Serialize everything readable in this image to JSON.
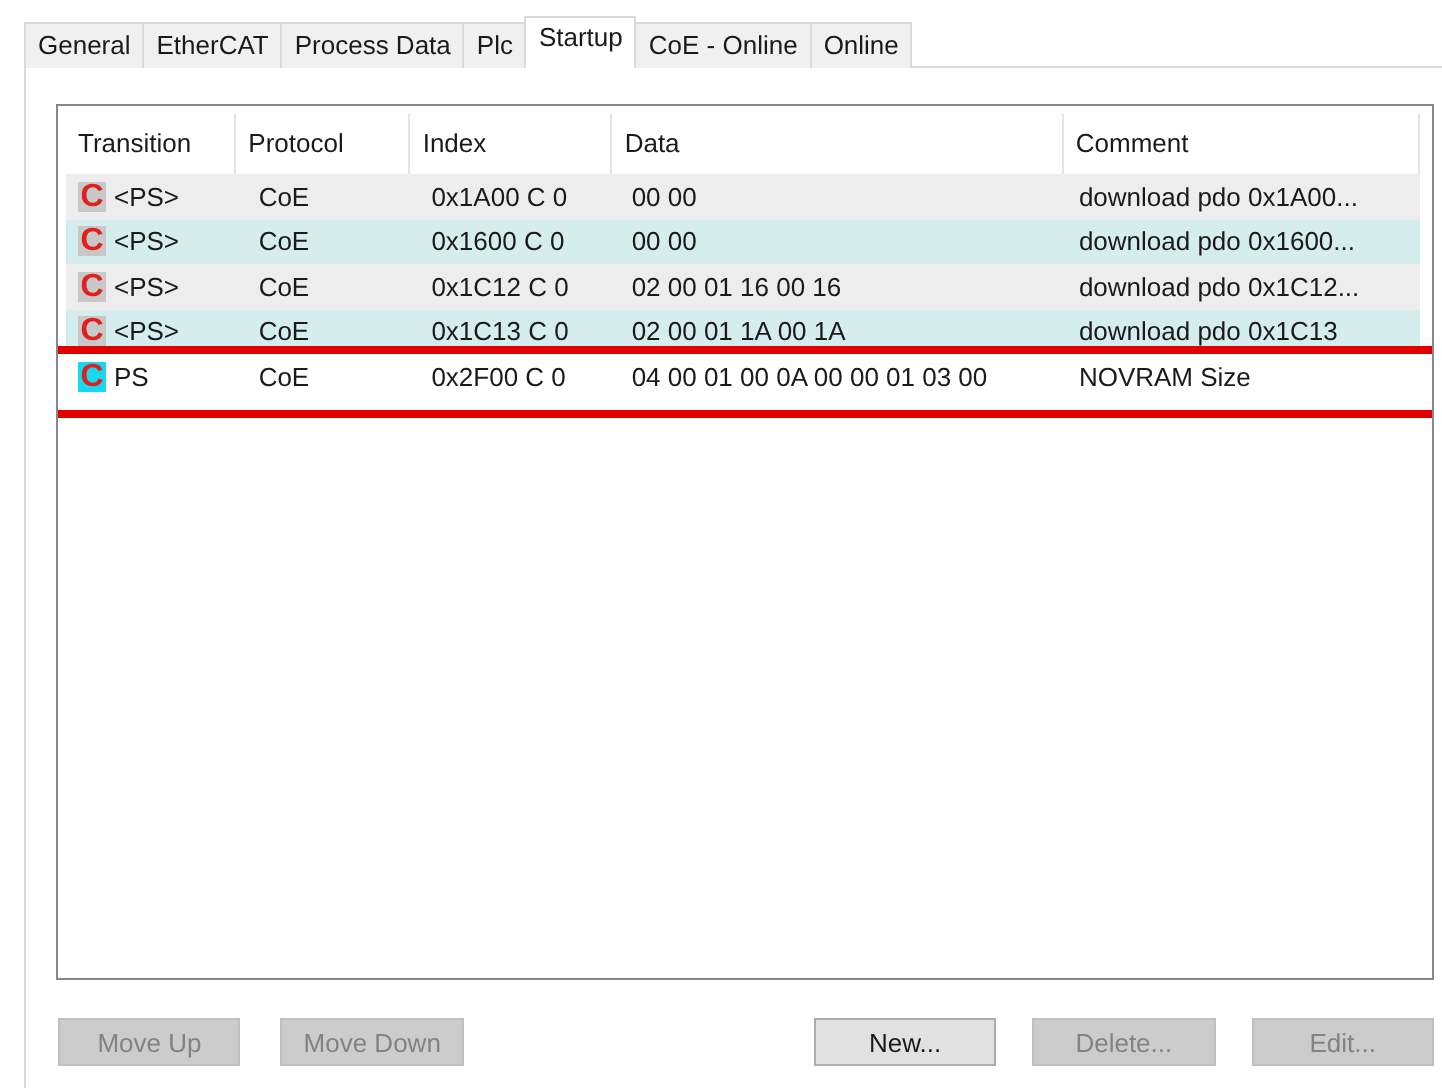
{
  "tabs": [
    {
      "label": "General",
      "selected": false
    },
    {
      "label": "EtherCAT",
      "selected": false
    },
    {
      "label": "Process Data",
      "selected": false
    },
    {
      "label": "Plc",
      "selected": false
    },
    {
      "label": "Startup",
      "selected": true
    },
    {
      "label": "CoE - Online",
      "selected": false
    },
    {
      "label": "Online",
      "selected": false
    }
  ],
  "table": {
    "columns": [
      "Transition",
      "Protocol",
      "Index",
      "Data",
      "Comment"
    ],
    "rows": [
      {
        "icon": "C",
        "color": "#c8c8c8",
        "transition": "<PS>",
        "protocol": "CoE",
        "index": "0x1A00 C 0",
        "data": "00 00",
        "comment": "download pdo 0x1A00...",
        "highlighted": false
      },
      {
        "icon": "C",
        "color": "#c8c8c8",
        "transition": "<PS>",
        "protocol": "CoE",
        "index": "0x1600 C 0",
        "data": "00 00",
        "comment": "download pdo 0x1600...",
        "highlighted": false
      },
      {
        "icon": "C",
        "color": "#c8c8c8",
        "transition": "<PS>",
        "protocol": "CoE",
        "index": "0x1C12 C 0",
        "data": "02 00 01 16 00 16",
        "comment": "download pdo 0x1C12...",
        "highlighted": false
      },
      {
        "icon": "C",
        "color": "#c8c8c8",
        "transition": "<PS>",
        "protocol": "CoE",
        "index": "0x1C13 C 0",
        "data": "02 00 01 1A 00 1A",
        "comment": "download pdo 0x1C13",
        "highlighted": false
      },
      {
        "icon": "C",
        "color": "#18d8f0",
        "transition": "PS",
        "protocol": "CoE",
        "index": "0x2F00 C 0",
        "data": "04 00 01 00 0A 00 00 01 03 00",
        "comment": "NOVRAM Size",
        "highlighted": true
      }
    ]
  },
  "buttons": [
    {
      "label": "Move Up",
      "disabled": true
    },
    {
      "label": "Move Down",
      "disabled": true
    },
    {
      "label": "New...",
      "disabled": false
    },
    {
      "label": "Delete...",
      "disabled": true
    },
    {
      "label": "Edit...",
      "disabled": true
    }
  ]
}
